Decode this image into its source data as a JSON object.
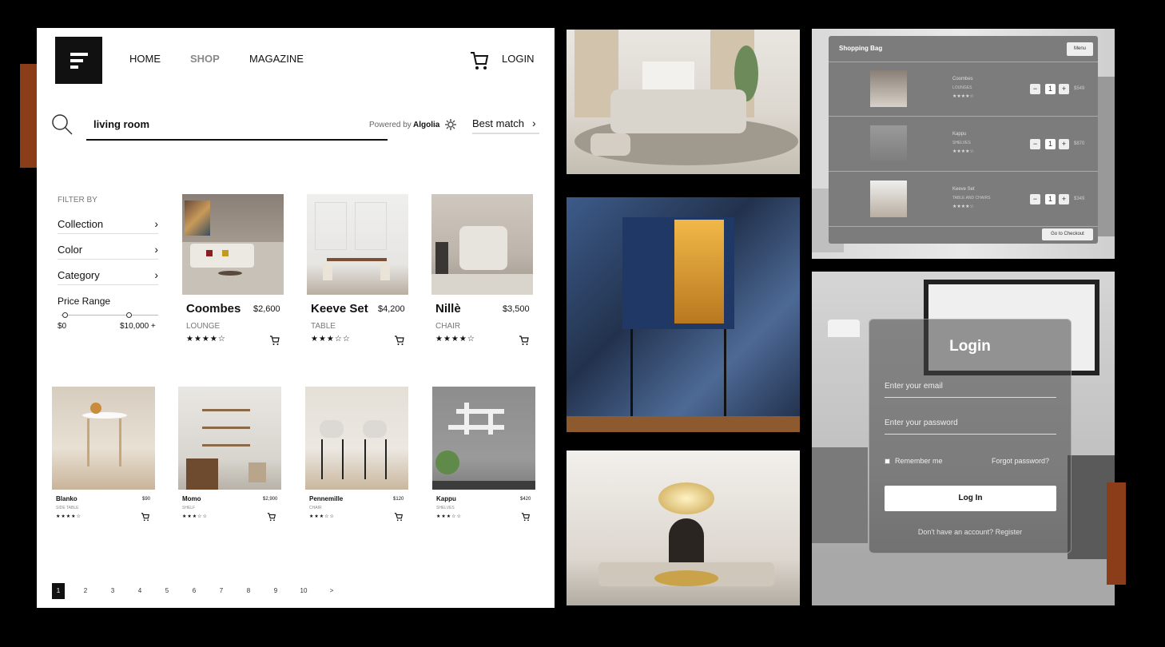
{
  "header": {
    "nav": [
      "HOME",
      "SHOP",
      "MAGAZINE"
    ],
    "login": "LOGIN"
  },
  "search": {
    "query": "living room",
    "powered_by": "Powered by",
    "brand": "Algolia",
    "sort": "Best match"
  },
  "filters": {
    "title": "FILTER BY",
    "items": [
      "Collection",
      "Color",
      "Category"
    ],
    "price_label": "Price Range",
    "price_min": "$0",
    "price_max": "$10,000 +"
  },
  "products_large": [
    {
      "name": "Coombes",
      "price": "$2,600",
      "category": "LOUNGE",
      "stars": "★★★★☆"
    },
    {
      "name": "Keeve Set",
      "price": "$4,200",
      "category": "TABLE",
      "stars": "★★★☆☆"
    },
    {
      "name": "Nillè",
      "price": "$3,500",
      "category": "CHAIR",
      "stars": "★★★★☆"
    }
  ],
  "products_small": [
    {
      "name": "Blanko",
      "price": "$90",
      "category": "SIDE TABLE",
      "stars": "★★★★☆"
    },
    {
      "name": "Momo",
      "price": "$2,900",
      "category": "SHELF",
      "stars": "★★★☆☆"
    },
    {
      "name": "Pennemille",
      "price": "$120",
      "category": "CHAIR",
      "stars": "★★★☆☆"
    },
    {
      "name": "Kappu",
      "price": "$420",
      "category": "SHELVES",
      "stars": "★★★☆☆"
    }
  ],
  "pagination": [
    "1",
    "2",
    "3",
    "4",
    "5",
    "6",
    "7",
    "8",
    "9",
    "10",
    ">"
  ],
  "bag": {
    "title": "Shopping Bag",
    "menu": "Menu",
    "checkout": "Go to Checkout",
    "items": [
      {
        "name": "Coombes",
        "category": "LOUNGES",
        "stars": "★★★★☆",
        "qty": "1",
        "price": "$549"
      },
      {
        "name": "Kappu",
        "category": "SHELVES",
        "stars": "★★★★☆",
        "qty": "1",
        "price": "$870"
      },
      {
        "name": "Keeve Set",
        "category": "TABLE AND CHAIRS",
        "stars": "★★★★☆",
        "qty": "1",
        "price": "$349"
      }
    ],
    "minus": "−",
    "plus": "+"
  },
  "login_form": {
    "title": "Login",
    "email_placeholder": "Enter your email",
    "password_placeholder": "Enter your password",
    "remember": "Remember me",
    "forgot": "Forgot password?",
    "button": "Log In",
    "register": "Don't have an account? Register"
  },
  "colors": {
    "accent": "#8b3d1a",
    "panel_gray": "#7c7c7c"
  }
}
